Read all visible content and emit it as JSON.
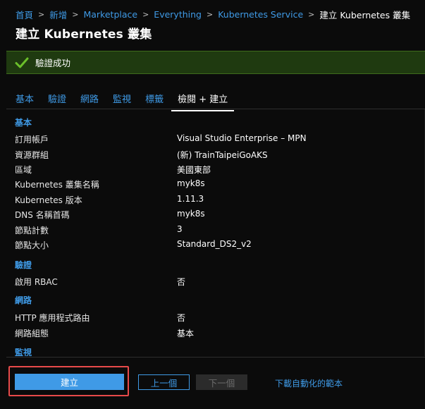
{
  "breadcrumb": {
    "items": [
      "首頁",
      "新增",
      "Marketplace",
      "Everything",
      "Kubernetes Service"
    ],
    "current": "建立 Kubernetes 叢集"
  },
  "title": "建立 Kubernetes 叢集",
  "banner": {
    "message": "驗證成功",
    "color": "#1f3a10",
    "icon": "checkmark-icon"
  },
  "tabs": [
    "基本",
    "驗證",
    "網路",
    "監視",
    "標籤",
    "檢閱 + 建立"
  ],
  "active_tab": "檢閱 + 建立",
  "review": {
    "basics": {
      "heading": "基本",
      "rows": [
        {
          "label": "訂用帳戶",
          "value": "Visual Studio Enterprise – MPN"
        },
        {
          "label": "資源群組",
          "value": "(新) TrainTaipeiGoAKS"
        },
        {
          "label": "區域",
          "value": "美國東部"
        },
        {
          "label": "Kubernetes 叢集名稱",
          "value": "myk8s"
        },
        {
          "label": "Kubernetes 版本",
          "value": "1.11.3"
        },
        {
          "label": "DNS 名稱首碼",
          "value": "myk8s"
        },
        {
          "label": "節點計數",
          "value": "3"
        },
        {
          "label": "節點大小",
          "value": "Standard_DS2_v2"
        }
      ]
    },
    "auth": {
      "heading": "驗證",
      "rows": [
        {
          "label": "啟用 RBAC",
          "value": "否"
        }
      ]
    },
    "network": {
      "heading": "網路",
      "rows": [
        {
          "label": "HTTP 應用程式路由",
          "value": "否"
        },
        {
          "label": "網路組態",
          "value": "基本"
        }
      ]
    },
    "monitor": {
      "heading": "監視"
    }
  },
  "footer": {
    "create_label": "建立",
    "prev_label": "上一個",
    "next_label": "下一個",
    "download_label": "下載自動化的範本"
  },
  "colors": {
    "accent": "#3f9ae6",
    "highlight": "#e74a4a",
    "background": "#0b0b0b"
  }
}
